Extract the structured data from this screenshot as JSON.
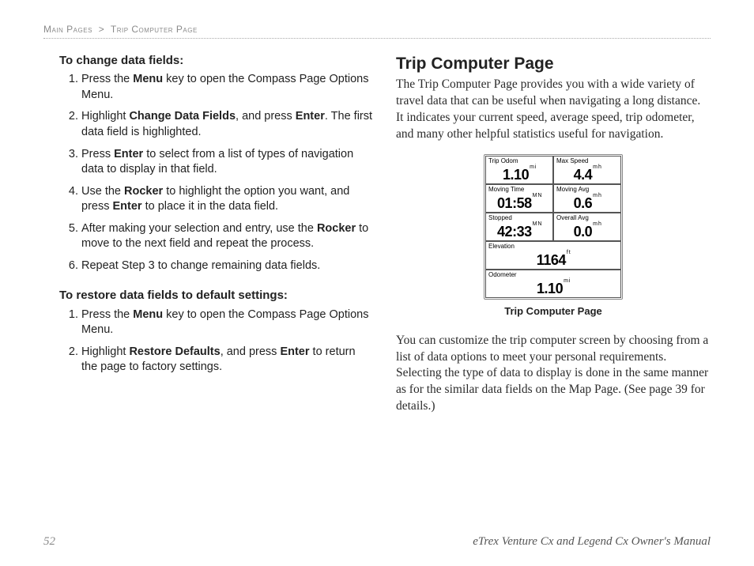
{
  "header": {
    "crumb1": "Main Pages",
    "sep": ">",
    "crumb2": "Trip Computer Page"
  },
  "left": {
    "sub1": "To change data fields:",
    "steps1": [
      {
        "pre": "Press the ",
        "b1": "Menu",
        "post": " key to open the Compass Page Options Menu."
      },
      {
        "pre": "Highlight ",
        "b1": "Change Data Fields",
        "mid": ", and press ",
        "b2": "Enter",
        "post": ". The first data field is highlighted."
      },
      {
        "pre": "Press ",
        "b1": "Enter",
        "post": " to select from a list of types of navigation data to display in that field."
      },
      {
        "pre": "Use the ",
        "b1": "Rocker",
        "mid": " to highlight the option you want, and press ",
        "b2": "Enter",
        "post": " to place it in the data field."
      },
      {
        "pre": "After making your selection and entry, use the ",
        "b1": "Rocker",
        "post": " to move to the next field and repeat the process."
      },
      {
        "pre": "Repeat Step 3 to change remaining data fields.",
        "b1": "",
        "post": ""
      }
    ],
    "sub2": "To restore data fields to default settings:",
    "steps2": [
      {
        "pre": "Press the ",
        "b1": "Menu",
        "post": " key to open the Compass Page Options Menu."
      },
      {
        "pre": "Highlight ",
        "b1": "Restore Defaults",
        "mid": ", and press ",
        "b2": "Enter",
        "post": " to return the page to factory settings."
      }
    ]
  },
  "right": {
    "title": "Trip Computer Page",
    "para1": "The Trip Computer Page provides you with a wide variety of travel data that can be useful when navigating a long distance. It indicates your current speed, average speed, trip odometer, and many other helpful statistics useful for navigation.",
    "caption": "Trip Computer Page",
    "para2": "You can customize the trip computer screen by choosing from a list of data options to meet your personal requirements. Selecting the type of data to display is done in the same manner as for the similar data fields on the Map Page. (See page 39 for details.)"
  },
  "device": {
    "cells": [
      {
        "label": "Trip Odom",
        "value": "1.10",
        "unit": "m\ni"
      },
      {
        "label": "Max Speed",
        "value": "4.4",
        "unit": "m\nh"
      },
      {
        "label": "Moving Time",
        "value": "01:58",
        "unit": "M\nN"
      },
      {
        "label": "Moving Avg",
        "value": "0.6",
        "unit": "m\nh"
      },
      {
        "label": "Stopped",
        "value": "42:33",
        "unit": "M\nN"
      },
      {
        "label": "Overall Avg",
        "value": "0.0",
        "unit": "m\nh"
      },
      {
        "label": "Elevation",
        "value": "1164",
        "unit": "f\nt",
        "wide": true
      },
      {
        "label": "Odometer",
        "value": "1.10",
        "unit": "m\ni",
        "wide": true
      }
    ]
  },
  "footer": {
    "page": "52",
    "manual": "eTrex Venture Cx and Legend Cx Owner's Manual"
  }
}
